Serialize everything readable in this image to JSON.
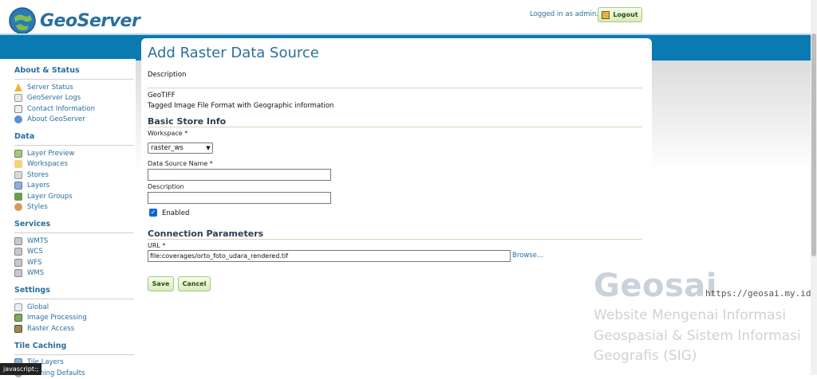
{
  "header": {
    "logo_text": "GeoServer",
    "login_text": "Logged in as admin.",
    "logout_label": "Logout"
  },
  "sidebar": {
    "sections": [
      {
        "title": "About & Status",
        "items": [
          "Server Status",
          "GeoServer Logs",
          "Contact Information",
          "About GeoServer"
        ]
      },
      {
        "title": "Data",
        "items": [
          "Layer Preview",
          "Workspaces",
          "Stores",
          "Layers",
          "Layer Groups",
          "Styles"
        ]
      },
      {
        "title": "Services",
        "items": [
          "WMTS",
          "WCS",
          "WFS",
          "WMS"
        ]
      },
      {
        "title": "Settings",
        "items": [
          "Global",
          "Image Processing",
          "Raster Access"
        ]
      },
      {
        "title": "Tile Caching",
        "items": [
          "Tile Layers",
          "Caching Defaults"
        ]
      }
    ]
  },
  "main": {
    "title": "Add Raster Data Source",
    "description_header": "Description",
    "source_type": "GeoTIFF",
    "source_type_desc": "Tagged Image File Format with Geographic information",
    "basic_store_info": "Basic Store Info",
    "workspace_label": "Workspace *",
    "workspace_value": "raster_ws",
    "datasource_name_label": "Data Source Name *",
    "datasource_name_value": "",
    "description_label": "Description",
    "description_value": "",
    "enabled_label": "Enabled",
    "enabled": true,
    "connection_parameters": "Connection Parameters",
    "url_label": "URL *",
    "url_value": "file:coverages/orto_foto_udara_rendered.tif",
    "browse_label": "Browse...",
    "save_label": "Save",
    "cancel_label": "Cancel"
  },
  "watermark": {
    "brand": "Geosai",
    "url": "https://geosai.my.id",
    "line1": "Website Mengenai Informasi",
    "line2": "Geospasial & Sistem Informasi",
    "line3": "Geografis (SIG)"
  },
  "status_bar": "javascript:;",
  "colors": {
    "accent": "#2a6f9e",
    "band": "#0a7ab3",
    "button_bg": "#d7ecb9"
  }
}
